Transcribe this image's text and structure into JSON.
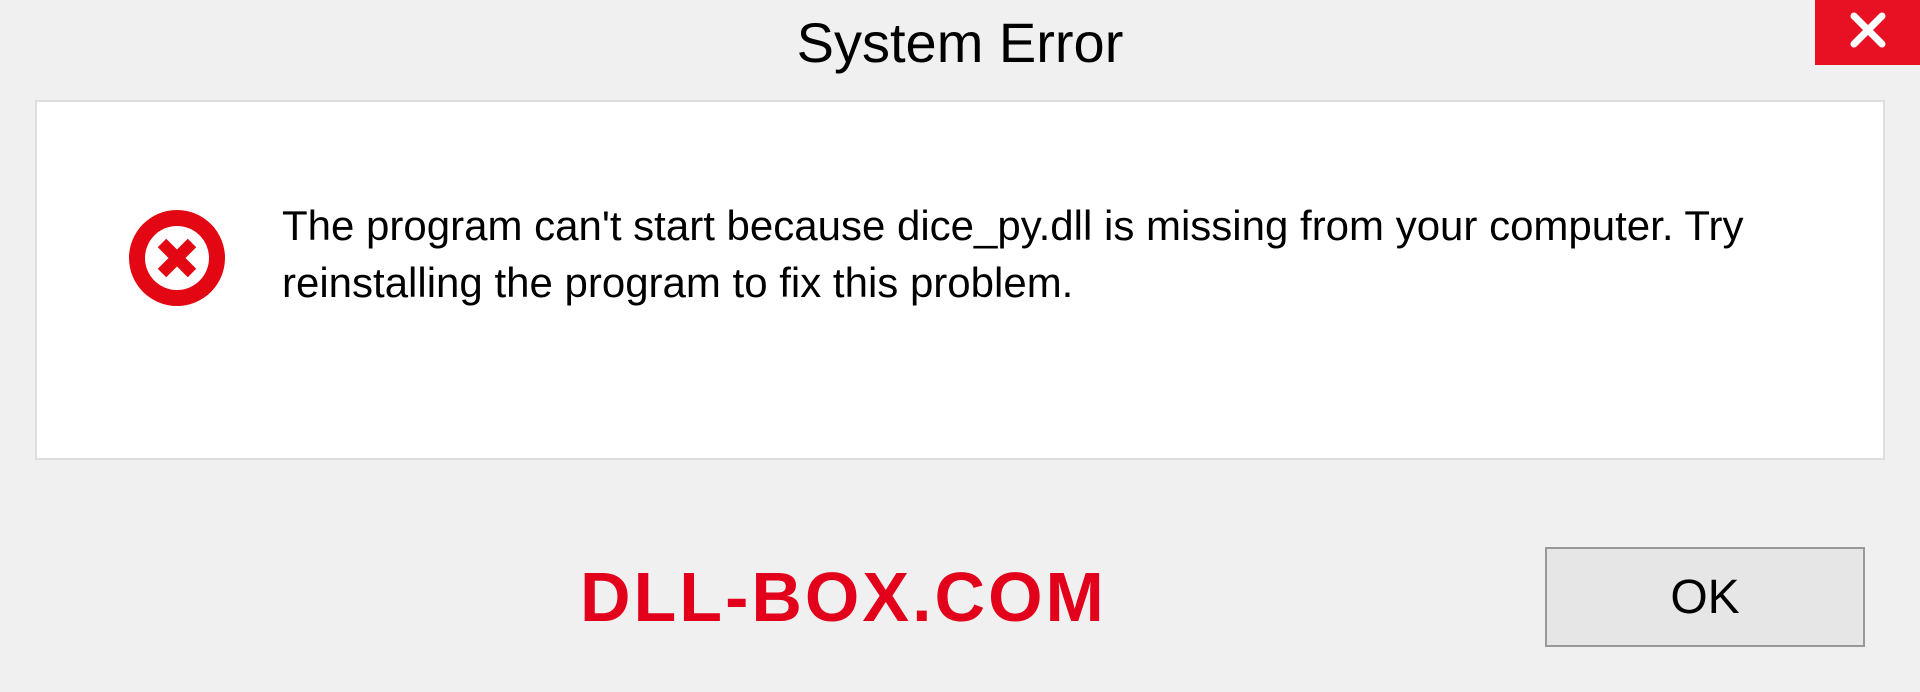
{
  "titlebar": {
    "title": "System Error"
  },
  "message": {
    "text": "The program can't start because dice_py.dll is missing from your computer. Try reinstalling the program to fix this problem."
  },
  "footer": {
    "watermark": "DLL-BOX.COM",
    "ok_label": "OK"
  }
}
